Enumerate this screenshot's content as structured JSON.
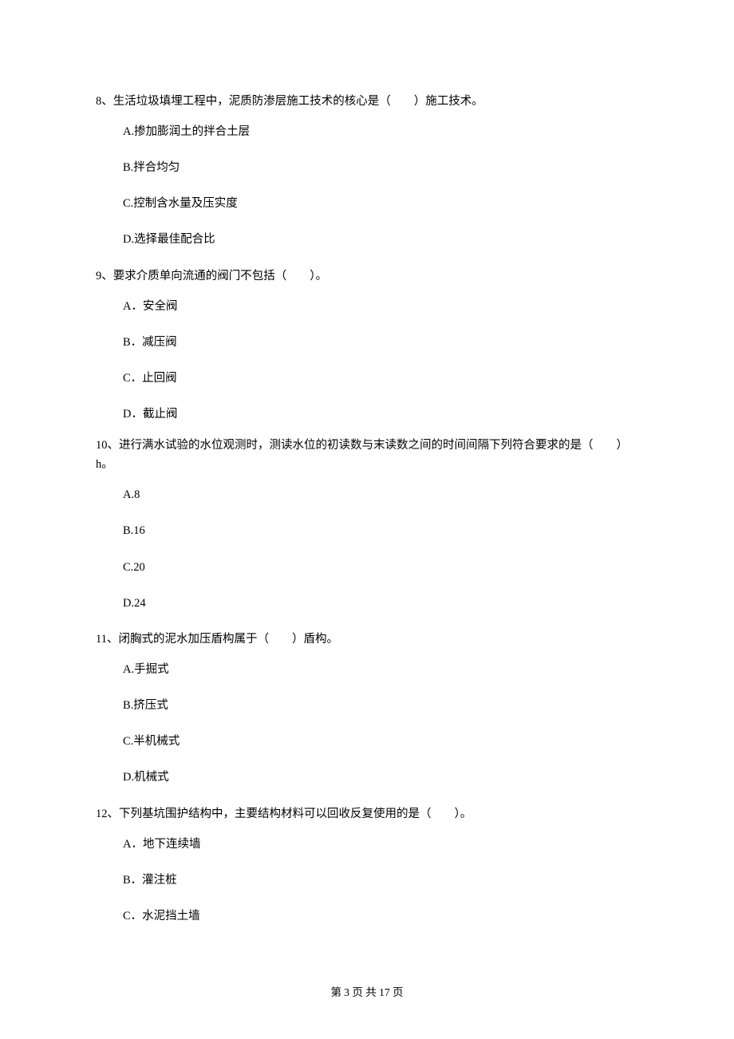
{
  "questions": [
    {
      "number": "8、",
      "stem": "生活垃圾填埋工程中，泥质防渗层施工技术的核心是（　　）施工技术。",
      "options": [
        "A.掺加膨润土的拌合土层",
        "B.拌合均匀",
        "C.控制含水量及压实度",
        "D.选择最佳配合比"
      ]
    },
    {
      "number": "9、",
      "stem": "要求介质单向流通的阀门不包括（　　）。",
      "options": [
        "A．安全阀",
        "B．减压阀",
        "C．止回阀",
        "D．截止阀"
      ]
    },
    {
      "number": "10、",
      "stem": "进行满水试验的水位观测时，测读水位的初读数与末读数之间的时间间隔下列符合要求的是（　　）h。",
      "options": [
        "A.8",
        "B.16",
        "C.20",
        "D.24"
      ]
    },
    {
      "number": "11、",
      "stem": "闭胸式的泥水加压盾构属于（　　）盾构。",
      "options": [
        "A.手掘式",
        "B.挤压式",
        "C.半机械式",
        "D.机械式"
      ]
    },
    {
      "number": "12、",
      "stem": "下列基坑围护结构中，主要结构材料可以回收反复使用的是（　　）。",
      "options": [
        "A．地下连续墙",
        "B．灌注桩",
        "C．水泥挡土墙"
      ]
    }
  ],
  "footer": "第 3 页 共 17 页"
}
